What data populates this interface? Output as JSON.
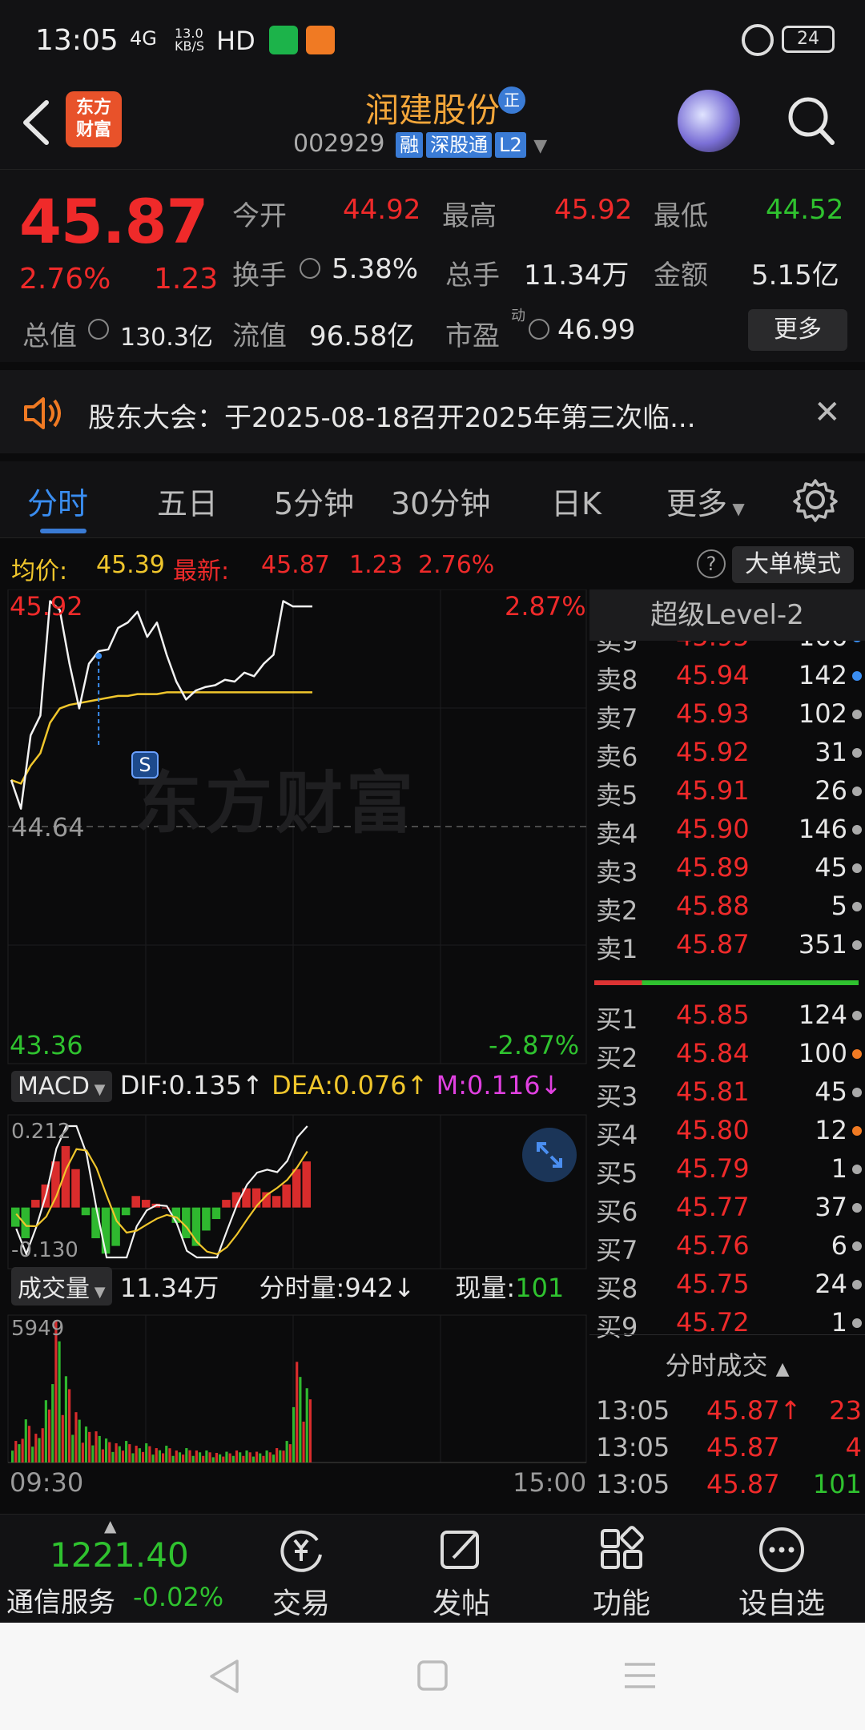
{
  "status_bar": {
    "time": "13:05",
    "signal": "4G",
    "net_speed_top": "13.0",
    "net_speed_unit": "KB/S",
    "hd": "HD",
    "battery": "24"
  },
  "header": {
    "logo_line1": "东方",
    "logo_line2": "财富",
    "title": "润建股份",
    "title_badge": "正",
    "code": "002929",
    "tag_margin": "融",
    "tag_connect": "深股通",
    "tag_level": "L2"
  },
  "quote": {
    "price": "45.87",
    "change_pct": "2.76%",
    "change": "1.23",
    "open_label": "今开",
    "open": "44.92",
    "high_label": "最高",
    "high": "45.92",
    "low_label": "最低",
    "low": "44.52",
    "turnover_label": "换手",
    "turnover": "5.38%",
    "volume_label": "总手",
    "volume": "11.34万",
    "amount_label": "金额",
    "amount": "5.15亿",
    "mktcap_label": "总值",
    "mktcap": "130.3亿",
    "float_label": "流值",
    "float": "96.58亿",
    "pe_label": "市盈",
    "pe_sup": "动",
    "pe": "46.99",
    "more": "更多"
  },
  "notice": {
    "text": "股东大会：于2025-08-18召开2025年第三次临..."
  },
  "tabs": [
    "分时",
    "五日",
    "5分钟",
    "30分钟",
    "日K",
    "更多"
  ],
  "summary": {
    "avg_label": "均价:",
    "avg": "45.39",
    "last_label": "最新:",
    "last": "45.87",
    "chg": "1.23",
    "pct": "2.76%",
    "big_mode": "大单模式",
    "help": "?"
  },
  "intraday": {
    "max_price": "45.92",
    "max_pct": "2.87%",
    "min_price": "43.36",
    "min_pct": "-2.87%",
    "prev_close": "44.64",
    "signal": "S",
    "watermark": "东方财富",
    "time_start": "09:30",
    "time_end": "15:00"
  },
  "macd": {
    "label": "MACD",
    "dif": "DIF:0.135",
    "dea": "DEA:0.076",
    "m": "M:0.116",
    "max": "0.212",
    "min": "-0.130",
    "arrow_up": "↑",
    "arrow_down": "↓"
  },
  "volume_panel": {
    "label": "成交量",
    "total": "11.34万",
    "tick_label": "分时量:942",
    "now_label": "现量:",
    "now": "101",
    "max": "5949",
    "arrow_down": "↓"
  },
  "level2": {
    "title": "超级Level-2",
    "asks": [
      {
        "label": "卖9",
        "price": "45.95",
        "vol": "166"
      },
      {
        "label": "卖8",
        "price": "45.94",
        "vol": "142"
      },
      {
        "label": "卖7",
        "price": "45.93",
        "vol": "102"
      },
      {
        "label": "卖6",
        "price": "45.92",
        "vol": "31"
      },
      {
        "label": "卖5",
        "price": "45.91",
        "vol": "26"
      },
      {
        "label": "卖4",
        "price": "45.90",
        "vol": "146"
      },
      {
        "label": "卖3",
        "price": "45.89",
        "vol": "45"
      },
      {
        "label": "卖2",
        "price": "45.88",
        "vol": "5"
      },
      {
        "label": "卖1",
        "price": "45.87",
        "vol": "351"
      }
    ],
    "bids": [
      {
        "label": "买1",
        "price": "45.85",
        "vol": "124"
      },
      {
        "label": "买2",
        "price": "45.84",
        "vol": "100"
      },
      {
        "label": "买3",
        "price": "45.81",
        "vol": "45"
      },
      {
        "label": "买4",
        "price": "45.80",
        "vol": "12"
      },
      {
        "label": "买5",
        "price": "45.79",
        "vol": "1"
      },
      {
        "label": "买6",
        "price": "45.77",
        "vol": "37"
      },
      {
        "label": "买7",
        "price": "45.76",
        "vol": "6"
      },
      {
        "label": "买8",
        "price": "45.75",
        "vol": "24"
      },
      {
        "label": "买9",
        "price": "45.72",
        "vol": "1"
      }
    ],
    "trades_title": "分时成交",
    "trades": [
      {
        "time": "13:05",
        "price": "45.87↑",
        "vol": "23"
      },
      {
        "time": "13:05",
        "price": "45.87",
        "vol": "4"
      },
      {
        "time": "13:05",
        "price": "45.87",
        "vol": "101"
      }
    ]
  },
  "bottom_nav": {
    "index_value": "1221.40",
    "index_name": "通信服务",
    "index_pct": "-0.02%",
    "trade": "交易",
    "post": "发帖",
    "func": "功能",
    "watch": "设自选"
  },
  "chart_data": [
    {
      "type": "line",
      "title": "",
      "series": [
        {
          "name": "最新",
          "x": [
            "09:30",
            "09:36",
            "09:42",
            "09:48",
            "09:54",
            "10:00",
            "10:06",
            "10:12",
            "10:18",
            "10:24",
            "10:30",
            "10:36",
            "10:42",
            "10:48",
            "10:54",
            "11:00",
            "11:06",
            "11:12",
            "11:18",
            "11:24",
            "11:30",
            "13:06",
            "13:12",
            "13:18",
            "13:24",
            "13:30",
            "13:36",
            "13:42",
            "13:48",
            "13:54",
            "14:00",
            "14:06"
          ],
          "values": [
            44.9,
            44.74,
            45.15,
            45.26,
            45.9,
            45.85,
            45.55,
            45.3,
            45.55,
            45.62,
            45.63,
            45.75,
            45.78,
            45.84,
            45.7,
            45.78,
            45.6,
            45.45,
            45.35,
            45.4,
            45.42,
            45.43,
            45.46,
            45.45,
            45.5,
            45.48,
            45.55,
            45.6,
            45.9,
            45.87,
            45.87,
            45.87
          ]
        },
        {
          "name": "均价",
          "values": [
            44.9,
            44.88,
            44.98,
            45.05,
            45.22,
            45.3,
            45.32,
            45.33,
            45.34,
            45.35,
            45.36,
            45.37,
            45.37,
            45.38,
            45.38,
            45.38,
            45.39,
            45.39,
            45.39,
            45.39,
            45.39,
            45.39,
            45.39,
            45.39,
            45.39,
            45.39,
            45.39,
            45.39,
            45.39,
            45.39,
            45.39,
            45.39
          ]
        }
      ],
      "ylim": [
        43.36,
        45.92
      ],
      "prev_close": 44.64,
      "xlabel": "",
      "ylabel": ""
    },
    {
      "type": "bar",
      "title": "",
      "values": [
        -0.05,
        -0.08,
        0.02,
        0.06,
        0.12,
        0.16,
        0.1,
        -0.02,
        -0.08,
        -0.12,
        -0.1,
        -0.02,
        0.03,
        0.02,
        0.01,
        0.0,
        -0.04,
        -0.08,
        -0.1,
        -0.06,
        -0.03,
        0.02,
        0.04,
        0.05,
        0.05,
        0.04,
        0.03,
        0.06,
        0.1,
        0.12
      ],
      "ylim": [
        -0.13,
        0.212
      ]
    },
    {
      "type": "bar",
      "title": "",
      "values": [
        900,
        1800,
        1200,
        2600,
        5949,
        3600,
        2100,
        1500,
        1300,
        1000,
        800,
        900,
        700,
        800,
        600,
        700,
        500,
        600,
        500,
        500,
        400,
        450,
        500,
        500,
        450,
        500,
        600,
        900,
        4200,
        3100
      ],
      "ylim": [
        0,
        5949
      ]
    }
  ]
}
